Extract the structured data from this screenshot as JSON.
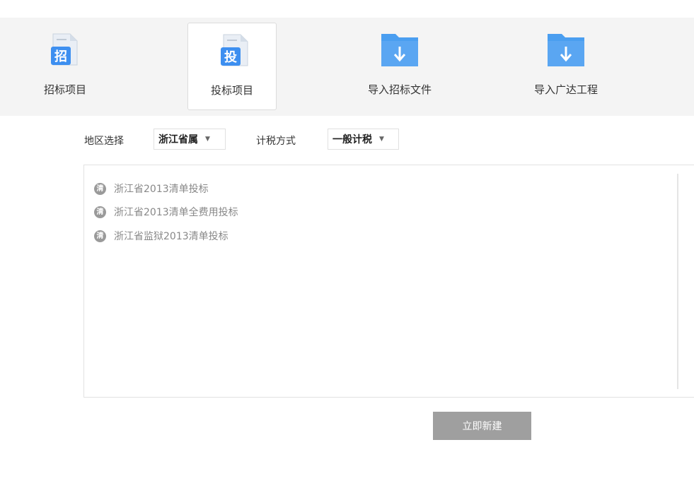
{
  "toolbar": {
    "items": [
      {
        "label": "招标项目",
        "icon": "zhao-document-icon",
        "glyph": "招",
        "active": false
      },
      {
        "label": "投标项目",
        "icon": "tou-document-icon",
        "glyph": "投",
        "active": true
      },
      {
        "label": "导入招标文件",
        "icon": "folder-import-icon",
        "active": false
      },
      {
        "label": "导入广达工程",
        "icon": "folder-import-icon",
        "active": false
      }
    ]
  },
  "filters": {
    "region_label": "地区选择",
    "region_value": "浙江省属",
    "tax_label": "计税方式",
    "tax_value": "一般计税"
  },
  "templates": {
    "badge_glyph": "清",
    "items": [
      "浙江省2013清单投标",
      "浙江省2013清单全费用投标",
      "浙江省监狱2013清单投标"
    ]
  },
  "actions": {
    "create_label": "立即新建"
  },
  "colors": {
    "toolbar_bg": "#f4f4f4",
    "icon_blue": "#3d8ff0",
    "folder_blue": "#5aa6f2",
    "button_gray": "#9f9f9f",
    "item_text": "#888888"
  }
}
